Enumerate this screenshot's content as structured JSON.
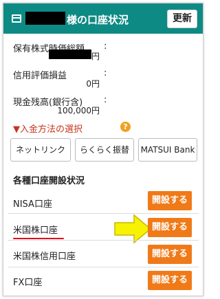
{
  "header": {
    "title": "様の口座状況",
    "update_label": "更新"
  },
  "summary": {
    "holdings_label": "保有株式時価総額",
    "holdings_value": "円",
    "unrealized_label": "信用評価損益",
    "unrealized_value": "0円",
    "cash_label": "現金残高(銀行含)",
    "cash_value": "100,000円",
    "colon": ":"
  },
  "deposit": {
    "label": "▼入金方法の選択",
    "help": "?",
    "methods": [
      "ネットリンク",
      "らくらく振替",
      "MATSUI Bank"
    ]
  },
  "accounts": {
    "title": "各種口座開設状況",
    "open_label": "開設する",
    "items": [
      {
        "label": "NISA口座"
      },
      {
        "label": "米国株口座"
      },
      {
        "label": "米国株信用口座"
      },
      {
        "label": "FX口座"
      }
    ]
  },
  "colors": {
    "header": "#0e8a85",
    "open_button": "#f07a18",
    "deposit_text": "#c8331a",
    "arrow": "#f7f200",
    "underline": "#e0001a"
  }
}
